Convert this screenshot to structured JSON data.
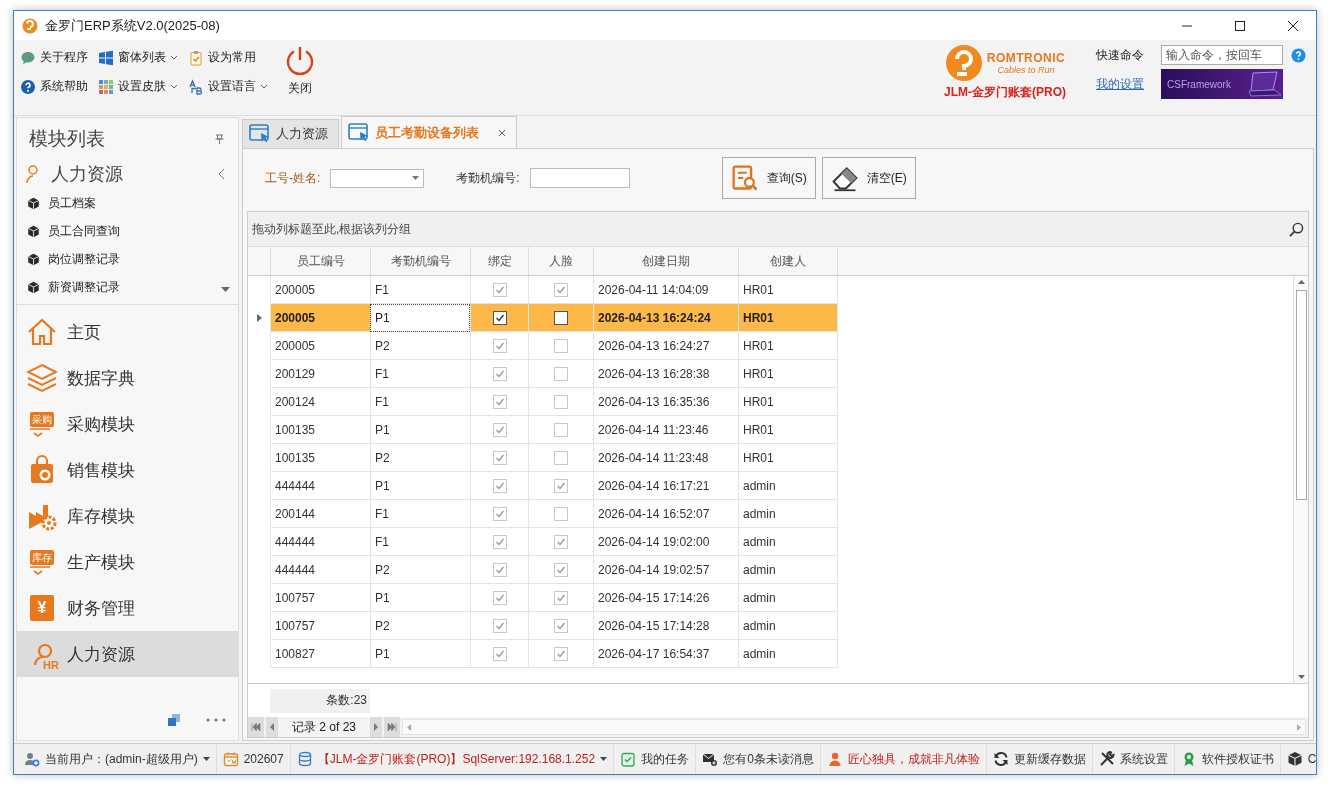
{
  "window": {
    "title": "金罗门ERP系统V2.0(2025-08)"
  },
  "toolbar": {
    "rows": [
      [
        {
          "label": "关于程序",
          "kind": "chat",
          "dropdown": false
        },
        {
          "label": "窗体列表",
          "kind": "windows",
          "dropdown": true
        },
        {
          "label": "设为常用",
          "kind": "clipboard",
          "dropdown": false
        }
      ],
      [
        {
          "label": "系统帮助",
          "kind": "help",
          "dropdown": false
        },
        {
          "label": "设置皮肤",
          "kind": "palette",
          "dropdown": true
        },
        {
          "label": "设置语言",
          "kind": "lang",
          "dropdown": true
        }
      ]
    ],
    "close_button": "关闭"
  },
  "brand": {
    "logo_name": "ROMTRONIC",
    "logo_slogan": "Cables to Run",
    "account": "JLM-金罗门账套(PRO)"
  },
  "quick_command": {
    "label": "快速命令",
    "placeholder": "输入命令，按回车"
  },
  "my_settings_link": "我的设置",
  "banner": "CSFramework",
  "sidebar": {
    "title": "模块列表",
    "group": {
      "label": "人力资源",
      "items": [
        "员工档案",
        "员工合同查询",
        "岗位调整记录",
        "薪资调整记录"
      ]
    },
    "modules": [
      {
        "label": "主页",
        "kind": "home",
        "selected": false
      },
      {
        "label": "数据字典",
        "kind": "layers",
        "selected": false
      },
      {
        "label": "采购模块",
        "kind": "tag",
        "icon_label": "采购",
        "selected": false
      },
      {
        "label": "销售模块",
        "kind": "bag",
        "selected": false
      },
      {
        "label": "库存模块",
        "kind": "factory",
        "selected": false
      },
      {
        "label": "生产模块",
        "kind": "tag",
        "icon_label": "库存",
        "selected": false
      },
      {
        "label": "财务管理",
        "kind": "money",
        "icon_label": "¥",
        "selected": false
      },
      {
        "label": "人力资源",
        "kind": "hr",
        "icon_label": "HR",
        "selected": true
      }
    ]
  },
  "tabs": [
    {
      "label": "人力资源",
      "selected": false,
      "closable": false
    },
    {
      "label": "员工考勤设备列表",
      "selected": true,
      "closable": true
    }
  ],
  "filters": [
    {
      "label": "工号-姓名:",
      "kind": "combo",
      "required": true
    },
    {
      "label": "考勤机编号:",
      "kind": "text",
      "required": false
    }
  ],
  "actions": [
    {
      "label": "查询(S)",
      "kind": "query"
    },
    {
      "label": "清空(E)",
      "kind": "eraser"
    }
  ],
  "grid": {
    "group_hint": "拖动列标题至此,根据该列分组",
    "columns": [
      "员工编号",
      "考勤机编号",
      "绑定",
      "人脸",
      "创建日期",
      "创建人"
    ],
    "rows": [
      {
        "employee_no": "200005",
        "device_no": "F1",
        "bound": true,
        "face": true,
        "created": "2026-04-11 14:04:09",
        "creator": "HR01",
        "selected": false
      },
      {
        "employee_no": "200005",
        "device_no": "P1",
        "bound": true,
        "face": false,
        "created": "2026-04-13 16:24:24",
        "creator": "HR01",
        "selected": true
      },
      {
        "employee_no": "200005",
        "device_no": "P2",
        "bound": true,
        "face": false,
        "created": "2026-04-13 16:24:27",
        "creator": "HR01",
        "selected": false
      },
      {
        "employee_no": "200129",
        "device_no": "F1",
        "bound": true,
        "face": false,
        "created": "2026-04-13 16:28:38",
        "creator": "HR01",
        "selected": false
      },
      {
        "employee_no": "200124",
        "device_no": "F1",
        "bound": true,
        "face": false,
        "created": "2026-04-13 16:35:36",
        "creator": "HR01",
        "selected": false
      },
      {
        "employee_no": "100135",
        "device_no": "P1",
        "bound": true,
        "face": false,
        "created": "2026-04-14 11:23:46",
        "creator": "HR01",
        "selected": false
      },
      {
        "employee_no": "100135",
        "device_no": "P2",
        "bound": true,
        "face": false,
        "created": "2026-04-14 11:23:48",
        "creator": "HR01",
        "selected": false
      },
      {
        "employee_no": "444444",
        "device_no": "P1",
        "bound": true,
        "face": true,
        "created": "2026-04-14 16:17:21",
        "creator": "admin",
        "selected": false
      },
      {
        "employee_no": "200144",
        "device_no": "F1",
        "bound": true,
        "face": false,
        "created": "2026-04-14 16:52:07",
        "creator": "admin",
        "selected": false
      },
      {
        "employee_no": "444444",
        "device_no": "F1",
        "bound": true,
        "face": true,
        "created": "2026-04-14 19:02:00",
        "creator": "admin",
        "selected": false
      },
      {
        "employee_no": "444444",
        "device_no": "P2",
        "bound": true,
        "face": true,
        "created": "2026-04-14 19:02:57",
        "creator": "admin",
        "selected": false
      },
      {
        "employee_no": "100757",
        "device_no": "P1",
        "bound": true,
        "face": true,
        "created": "2026-04-15 17:14:26",
        "creator": "admin",
        "selected": false
      },
      {
        "employee_no": "100757",
        "device_no": "P2",
        "bound": true,
        "face": true,
        "created": "2026-04-15 17:14:28",
        "creator": "admin",
        "selected": false
      },
      {
        "employee_no": "100827",
        "device_no": "P1",
        "bound": true,
        "face": true,
        "created": "2026-04-17 16:54:37",
        "creator": "admin",
        "selected": false
      }
    ],
    "footer": "条数:23",
    "record_nav": "记录 2 of 23"
  },
  "status_bar": [
    {
      "label": "当前用户：(admin-超级用户)",
      "kind": "user",
      "dropdown": true,
      "alert": false
    },
    {
      "label": "202607",
      "kind": "calendar",
      "dropdown": false,
      "alert": false
    },
    {
      "label": "【JLM-金罗门账套(PRO)】SqlServer:192.168.1.252",
      "kind": "database",
      "dropdown": true,
      "alert": true
    },
    {
      "label": "我的任务",
      "kind": "task",
      "dropdown": false,
      "alert": false
    },
    {
      "label": "您有0条未读消息",
      "kind": "mail",
      "dropdown": false,
      "alert": false
    },
    {
      "label": "匠心独具，成就非凡体验",
      "kind": "person",
      "dropdown": false,
      "alert": true
    },
    {
      "label": "更新缓存数据",
      "kind": "refresh",
      "dropdown": false,
      "alert": false
    },
    {
      "label": "系统设置",
      "kind": "tools",
      "dropdown": false,
      "alert": false
    },
    {
      "label": "软件授权证书",
      "kind": "award",
      "dropdown": false,
      "alert": false
    },
    {
      "label": "C",
      "kind": "cube",
      "dropdown": false,
      "alert": false
    }
  ]
}
